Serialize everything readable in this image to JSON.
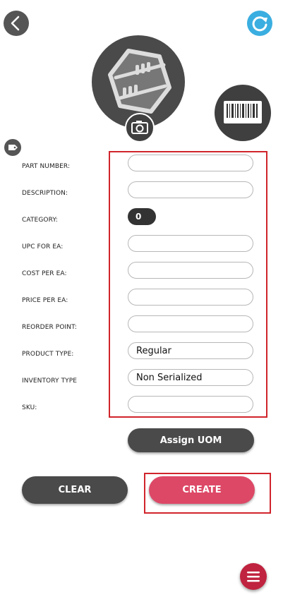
{
  "icons": {
    "back": "chevron-left-icon",
    "refresh": "refresh-icon",
    "product_image": "product-placeholder-icon",
    "camera": "camera-icon",
    "barcode": "barcode-icon",
    "tag": "tag-icon",
    "menu": "hamburger-menu-icon"
  },
  "colors": {
    "accent": "#3aaee0",
    "create": "#dd4866",
    "dark_button": "#4a4a4a",
    "menu": "#c0233f",
    "highlight": "#d0242b"
  },
  "form": {
    "part_number": {
      "label": "PART NUMBER:",
      "value": ""
    },
    "description": {
      "label": "DESCRIPTION:",
      "value": ""
    },
    "category": {
      "label": "CATEGORY:",
      "value": "0"
    },
    "upc": {
      "label": "UPC FOR EA:",
      "value": ""
    },
    "cost": {
      "label": "COST PER EA:",
      "value": ""
    },
    "price": {
      "label": "PRICE PER EA:",
      "value": ""
    },
    "reorder": {
      "label": "REORDER POINT:",
      "value": ""
    },
    "product_type": {
      "label": "PRODUCT TYPE:",
      "value": "Regular"
    },
    "inventory_type": {
      "label": "INVENTORY TYPE",
      "value": "Non Serialized"
    },
    "sku": {
      "label": "SKU:",
      "value": ""
    }
  },
  "buttons": {
    "assign_uom": "Assign UOM",
    "clear": "CLEAR",
    "create": "CREATE"
  }
}
